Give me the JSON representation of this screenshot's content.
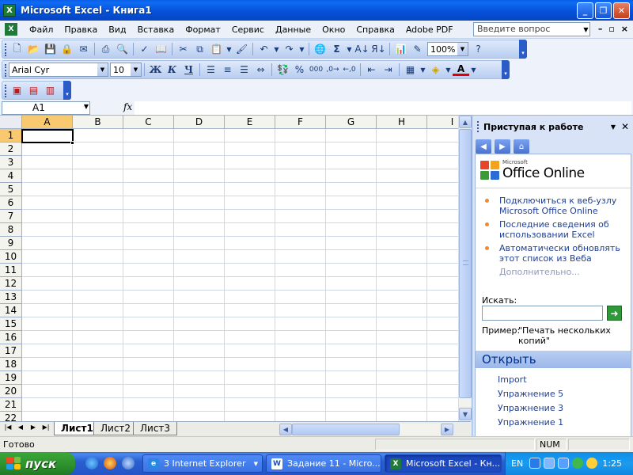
{
  "window": {
    "title": "Microsoft Excel - Книга1",
    "app_icon": "excel-icon",
    "controls": {
      "minimize": "_",
      "restore": "❐",
      "close": "✕"
    }
  },
  "menu": {
    "items": [
      "Файл",
      "Правка",
      "Вид",
      "Вставка",
      "Формат",
      "Сервис",
      "Данные",
      "Окно",
      "Справка",
      "Adobe PDF"
    ],
    "help_placeholder": "Введите вопрос",
    "mdi": {
      "minimize": "–",
      "restore": "▫",
      "close": "×"
    }
  },
  "toolbar_standard": {
    "zoom": "100%",
    "icons": [
      "new-icon",
      "open-icon",
      "save-icon",
      "permission-icon",
      "email-icon",
      "print-icon",
      "print-preview-icon",
      "spelling-icon",
      "research-icon",
      "cut-icon",
      "copy-icon",
      "paste-icon",
      "format-painter-icon",
      "undo-icon",
      "redo-icon",
      "hyperlink-icon",
      "autosum-icon",
      "sort-asc-icon",
      "sort-desc-icon",
      "chart-wizard-icon",
      "drawing-icon",
      "help-icon"
    ]
  },
  "toolbar_formatting": {
    "font": "Arial Cyr",
    "size": "10",
    "bold": "Ж",
    "italic": "К",
    "underline": "Ч",
    "percent": "%",
    "thousands": "000",
    "font_color_glyph": "A"
  },
  "formula_bar": {
    "name_box": "A1",
    "fx": "fx",
    "content": ""
  },
  "grid": {
    "columns": [
      "A",
      "B",
      "C",
      "D",
      "E",
      "F",
      "G",
      "H",
      "I"
    ],
    "rows": [
      "1",
      "2",
      "3",
      "4",
      "5",
      "6",
      "7",
      "8",
      "9",
      "10",
      "11",
      "12",
      "13",
      "14",
      "15",
      "16",
      "17",
      "18",
      "19",
      "20",
      "21",
      "22"
    ],
    "active_cell": "A1"
  },
  "sheets": {
    "tabs": [
      "Лист1",
      "Лист2",
      "Лист3"
    ],
    "active": "Лист1"
  },
  "task_pane": {
    "title": "Приступая к работе",
    "logo_small": "Microsoft",
    "logo_text": "Office Online",
    "links": [
      "Подключиться к веб-узлу Microsoft Office Online",
      "Последние сведения об использовании Excel",
      "Автоматически обновлять этот список из Веба"
    ],
    "more": "Дополнительно...",
    "search_label": "Искать:",
    "search_value": "",
    "example_label": "Пример:",
    "example_text": "\"Печать нескольких копий\"",
    "open_section": "Открыть",
    "files": [
      "Import",
      "Упражнение 5",
      "Упражнение 3",
      "Упражнение 1"
    ]
  },
  "status_bar": {
    "status": "Готово",
    "indicator": "NUM"
  },
  "taskbar": {
    "start_label": "пуск",
    "tasks": [
      {
        "label": "3 Internet Explorer",
        "icon": "ie-icon",
        "active": false
      },
      {
        "label": "Задание 11 - Micro...",
        "icon": "word-icon",
        "active": false
      },
      {
        "label": "Microsoft Excel - Кн...",
        "icon": "excel-icon",
        "active": true
      }
    ],
    "language": "EN",
    "clock": "1:25"
  }
}
